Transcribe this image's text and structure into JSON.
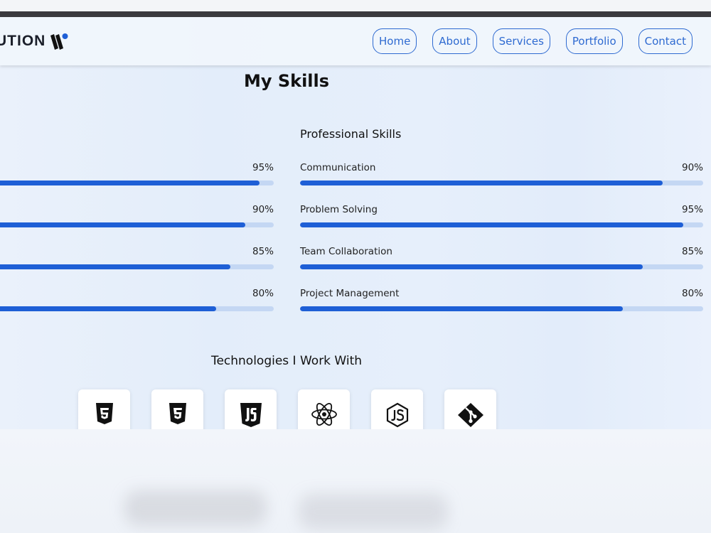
{
  "header": {
    "logo_text": "UTION",
    "nav": [
      "Home",
      "About",
      "Services",
      "Portfolio",
      "Contact"
    ]
  },
  "skills_section": {
    "title": "My Skills",
    "left_column": {
      "skills": [
        {
          "label": "",
          "percent": "95%",
          "value": 95
        },
        {
          "label": "",
          "percent": "90%",
          "value": 90
        },
        {
          "label": "",
          "percent": "85%",
          "value": 85
        },
        {
          "label": "",
          "percent": "80%",
          "value": 80
        }
      ]
    },
    "professional": {
      "title": "Professional Skills",
      "skills": [
        {
          "label": "Communication",
          "percent": "90%",
          "value": 90
        },
        {
          "label": "Problem Solving",
          "percent": "95%",
          "value": 95
        },
        {
          "label": "Team Collaboration",
          "percent": "85%",
          "value": 85
        },
        {
          "label": "Project Management",
          "percent": "80%",
          "value": 80
        }
      ]
    }
  },
  "technologies": {
    "title": "Technologies I Work With",
    "icons": [
      "html5-icon",
      "css3-icon",
      "javascript-icon",
      "react-icon",
      "nodejs-icon",
      "git-icon"
    ]
  },
  "colors": {
    "accent": "#2e6ad1",
    "bar_fill": "#1e5fd6",
    "bar_track": "#c4d7f3"
  }
}
